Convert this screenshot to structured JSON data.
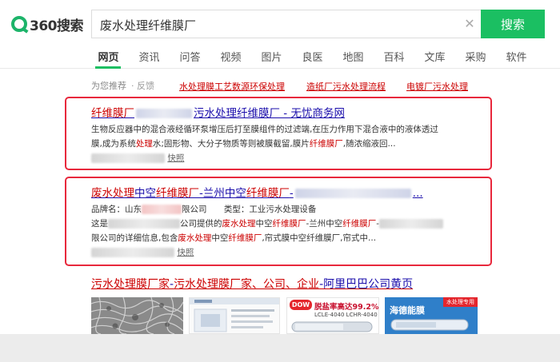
{
  "logo": {
    "text": "360搜索"
  },
  "search": {
    "query": "废水处理纤维膜厂",
    "button": "搜索"
  },
  "nav": [
    "网页",
    "资讯",
    "问答",
    "视频",
    "图片",
    "良医",
    "地图",
    "百科",
    "文库",
    "采购",
    "软件"
  ],
  "recommend": {
    "label": "为您推荐",
    "feedback": "反馈",
    "links": [
      "水处理膜工艺数源环保处理",
      "造纸厂污水处理流程",
      "电镀厂污水处理"
    ]
  },
  "result1": {
    "title_a": "纤维膜厂",
    "title_b": "污水处理纤维膜厂 - 无忧商务网",
    "line1": "生物反应器中的混合液经循环泵增压后打至膜组件的过滤端,在压力作用下混合液中的液体透过",
    "line2_a": "膜,成为系统",
    "line2_hl1": "处理",
    "line2_b": "水;固形物、大分子物质等则被膜截留,膜片",
    "line2_hl2": "纤维膜厂",
    "line2_c": ",随浓缩液回...",
    "snapshot": "快照"
  },
  "result2": {
    "title_a": "废水处理",
    "title_b": "中空",
    "title_c": "纤维膜厂",
    "title_d": "-兰州中空",
    "title_e": "纤维膜厂",
    "title_f": "-",
    "title_g": "...",
    "meta_brand_label": "品牌名：山东",
    "meta_brand_tail": "限公司",
    "meta_type": "类型：工业污水处理设备",
    "line1_a": "这是",
    "line1_b": "公司提供的",
    "line1_hl1": "废水处理",
    "line1_c": "中空",
    "line1_hl2": "纤维膜厂",
    "line1_d": "-兰州中空",
    "line1_hl3": "纤维膜厂",
    "line1_e": "-",
    "line2_a": "限公司的详细信息,包含",
    "line2_hl1": "废水处理",
    "line2_b": "中空",
    "line2_hl2": "纤维膜厂",
    "line2_c": ",帘式膜中空纤维膜厂,帘式中...",
    "snapshot": "快照"
  },
  "aliba": {
    "title_a": "污水处理膜厂家",
    "title_b": "-",
    "title_c": "污水处理膜厂家、公司、企业",
    "title_d": "-阿里巴巴公司黄页"
  },
  "thumbs": {
    "t3_brand": "DOW",
    "t3_line1": "脱盐率高达99.2%",
    "t3_line2": "LCLE-4040 LCHR-4040",
    "t4_title": "海德能膜",
    "t4_tag": "水处理专用"
  },
  "colors": {
    "accent": "#1bbf62",
    "highlight": "#cc0000",
    "link": "#1a0dab",
    "frame": "#e8283c"
  }
}
